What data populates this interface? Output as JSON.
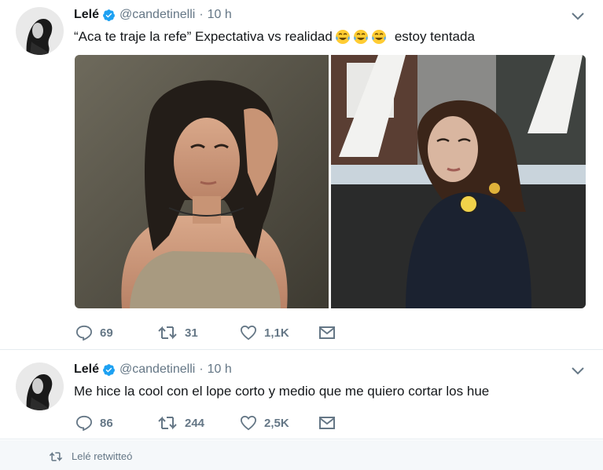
{
  "tweets": [
    {
      "name": "Lelé",
      "handle": "@candetinelli",
      "separator": "·",
      "time": "10 h",
      "text_before": "“Aca te traje la refe” Expectativa vs realidad",
      "emoji": [
        "face-with-tears-of-joy",
        "face-with-tears-of-joy",
        "face-with-tears-of-joy"
      ],
      "text_after": "estoy tentada",
      "media": [
        "photo-woman-dark-hair-beige-top",
        "photo-woman-dark-jacket-pins"
      ],
      "replies": "69",
      "retweets": "31",
      "likes": "1,1K"
    },
    {
      "name": "Lelé",
      "handle": "@candetinelli",
      "separator": "·",
      "time": "10 h",
      "text": "Me hice la cool con el lope corto y medio que me quiero cortar los hue",
      "replies": "86",
      "retweets": "244",
      "likes": "2,5K"
    }
  ],
  "retweet_notice": "Lelé retwitteó",
  "colors": {
    "verified": "#1da1f2",
    "muted": "#657786",
    "text": "#14171a",
    "divider": "#e6ecf0"
  },
  "icons": [
    "verified-badge-icon",
    "chevron-down-icon",
    "reply-icon",
    "retweet-icon",
    "heart-icon",
    "message-icon",
    "emoji-tears-of-joy-icon"
  ]
}
